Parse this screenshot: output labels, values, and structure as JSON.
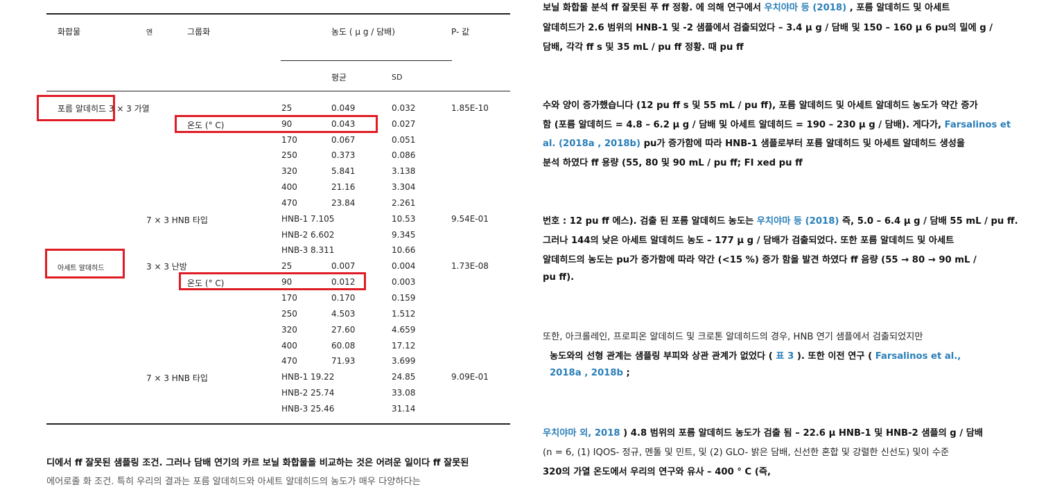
{
  "table": {
    "headers": {
      "compound": "화합물",
      "en": "엔",
      "group": "그룹화",
      "concentration": "농도 ( μ g / 담배)",
      "p_value": "P- 값",
      "mean": "평균",
      "sd": "SD"
    },
    "sections": [
      {
        "compound": "포름 알데히드 3 × 3 가열",
        "group_label": "온도 (° C)",
        "p": "1.85E-10",
        "rows": [
          {
            "g": "25",
            "mean": "0.049",
            "sd": "0.032"
          },
          {
            "g": "90",
            "mean": "0.043",
            "sd": "0.027"
          },
          {
            "g": "170",
            "mean": "0.067",
            "sd": "0.051"
          },
          {
            "g": "250",
            "mean": "0.373",
            "sd": "0.086"
          },
          {
            "g": "320",
            "mean": "5.841",
            "sd": "3.138"
          },
          {
            "g": "400",
            "mean": "21.16",
            "sd": "3.304"
          },
          {
            "g": "470",
            "mean": "23.84",
            "sd": "2.261"
          }
        ],
        "hnb_label": "7 × 3 HNB 타입",
        "hnb_p": "9.54E-01",
        "hnb_rows": [
          {
            "g": "HNB-1 7.105",
            "sd": "10.53"
          },
          {
            "g": "HNB-2 6.602",
            "sd": "9.345"
          },
          {
            "g": "HNB-3 8.311",
            "sd": "10.66"
          }
        ]
      },
      {
        "compound": "아세트 알데히드",
        "heating": "3 × 3 난방",
        "group_label": "온도 (° C)",
        "p": "1.73E-08",
        "rows": [
          {
            "g": "25",
            "mean": "0.007",
            "sd": "0.004"
          },
          {
            "g": "90",
            "mean": "0.012",
            "sd": "0.003"
          },
          {
            "g": "170",
            "mean": "0.170",
            "sd": "0.159"
          },
          {
            "g": "250",
            "mean": "4.503",
            "sd": "1.512"
          },
          {
            "g": "320",
            "mean": "27.60",
            "sd": "4.659"
          },
          {
            "g": "400",
            "mean": "60.08",
            "sd": "17.12"
          },
          {
            "g": "470",
            "mean": "71.93",
            "sd": "3.699"
          }
        ],
        "hnb_label": "7 × 3 HNB 타입",
        "hnb_p": "9.09E-01",
        "hnb_rows": [
          {
            "g": "HNB-1 19.22",
            "sd": "24.85"
          },
          {
            "g": "HNB-2 25.74",
            "sd": "33.08"
          },
          {
            "g": "HNB-3 25.46",
            "sd": "31.14"
          }
        ]
      }
    ]
  },
  "bottom_left": {
    "line1": "디에서 ff 잘못된 샘플링 조건. 그러나 담배 연기의 카르 보닐 화합물을 비교하는 것은 어려운 일이다 ff 잘못된",
    "line2": "에어로졸 화 조건. 특히 우리의 결과는 포름 알데히드와 아세트 알데히드의 농도가 매우 다양하다는"
  },
  "right": {
    "p1": {
      "l1a": "보닐 화합물 분석 ff 잘못된 푸 ff 정황. 에 의해 연구에서 ",
      "l1link": "우치야마 등 (2018)",
      "l1b": " , 포름 알데히드 및 아세트",
      "l2": "알데히드가 2.6 범위의 HNB-1 및 -2 샘플에서 검출되었다 – 3.4 μ g / 담배 및 150 – 160 μ 6 pu의 밀에 g /",
      "l3": "담배, 각각 ff s 및 35 mL / pu ff 정황. 때 pu ff"
    },
    "p2": {
      "l1": "수와 양이 증가했습니다 (12 pu ff s 및 55 mL / pu ff), 포름 알데히드 및 아세트 알데히드 농도가 약간 증가",
      "l2a": "함 (포름 알데히드 = 4.8 – 6.2 μ g / 담배 및 아세트 알데히드 = 190 – 230 μ g / 담배). 게다가, ",
      "l2link": "Farsalinos et",
      "l3link": "al. (2018a , 2018b)",
      "l3b": " pu가 증가함에 따라 HNB-1 샘플로부터 포름 알데히드 및 아세트 알데히드 생성을",
      "l4": "분석 하였다 ff 용량 (55, 80 및 90 mL / pu ff; FI xed pu ff"
    },
    "p3": {
      "l1a": "번호 : 12 pu ff 에스). 검출 된 포름 알데히드 농도는 ",
      "l1link": "우치야마 등 (2018)",
      "l1b": " 즉, 5.0 – 6.4 μ g / 담배 55 mL / pu ff.",
      "l2": "그러나 144의 낮은 아세트 알데히드 농도 – 177 μ g / 담배가 검출되었다. 또한 포름 알데히드 및 아세트",
      "l3": "알데히드의 농도는 pu가 증가함에 따라 약간 (<15 %) 증가 함을 발견 하였다 ff 음량 (55 → 80 → 90 mL /",
      "l4": "pu ff)."
    },
    "p4": {
      "l1": "또한, 아크롤레인, 프로피온 알데히드 및 크로톤 알데히드의 경우, HNB 연기 샘플에서 검출되었지만",
      "l2a": "농도와의 선형 관계는 샘플링 부피와 상관 관계가 없었다 ( ",
      "l2link1": "표 3",
      "l2b": " ). 또한 이전 연구 ( ",
      "l2link2": "Farsalinos et al.,",
      "l3link": "2018a , 2018b",
      "l3b": " ;"
    },
    "p5": {
      "l1link": "우치야마 외, 2018",
      "l1b": " ) 4.8 범위의 포름 알데히드 농도가 검출 됨 – 22.6 μ HNB-1 및 HNB-2 샘플의 g / 담배",
      "l2": "(n = 6, (1) IQOS- 정규, 멘톨 및 민트, 및 (2) GLO- 밝은 담배, 신선한 혼합 및 강렬한 신선도) 및이 수준",
      "l3": "320의 가열 온도에서 우리의 연구와 유사 – 400 ° C (즉,"
    }
  }
}
